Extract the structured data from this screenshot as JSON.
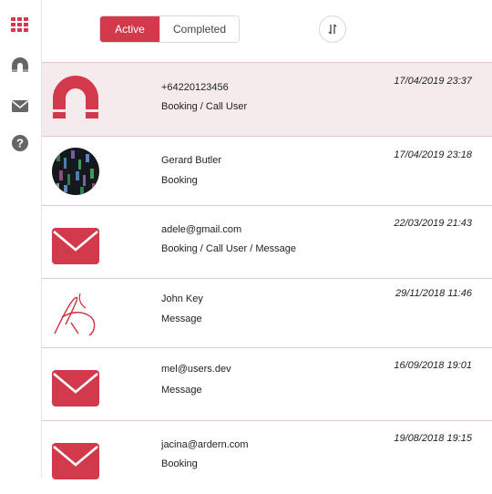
{
  "colors": {
    "accent": "#d23a4c",
    "highlight_row": "#f5ebec",
    "divider": "#e4c6cb"
  },
  "sidebar": {
    "items": [
      {
        "icon": "grid-icon"
      },
      {
        "icon": "magnet-icon"
      },
      {
        "icon": "envelope-icon"
      },
      {
        "icon": "help-icon"
      }
    ]
  },
  "header": {
    "tabs": {
      "active": "Active",
      "completed": "Completed"
    },
    "sort_icon": "sort-arrows-icon"
  },
  "list": [
    {
      "title": "+64220123456",
      "subtitle": "Booking / Call User",
      "date": "17/04/2019 23:37",
      "avatar": "magnet-icon"
    },
    {
      "title": "Gerard Butler",
      "subtitle": "Booking",
      "date": "17/04/2019 23:18",
      "avatar": "photo"
    },
    {
      "title": "adele@gmail.com",
      "subtitle": "Booking / Call User / Message",
      "date": "22/03/2019 21:43",
      "avatar": "envelope-icon"
    },
    {
      "title": "John Key",
      "subtitle": "Message",
      "date": "29/11/2018 11:46",
      "avatar": "signature"
    },
    {
      "title": "mel@users.dev",
      "subtitle": "Message",
      "date": "16/09/2018 19:01",
      "avatar": "envelope-icon"
    },
    {
      "title": "jacina@ardern.com",
      "subtitle": "Booking",
      "date": "19/08/2018 19:15",
      "avatar": "envelope-icon"
    }
  ]
}
